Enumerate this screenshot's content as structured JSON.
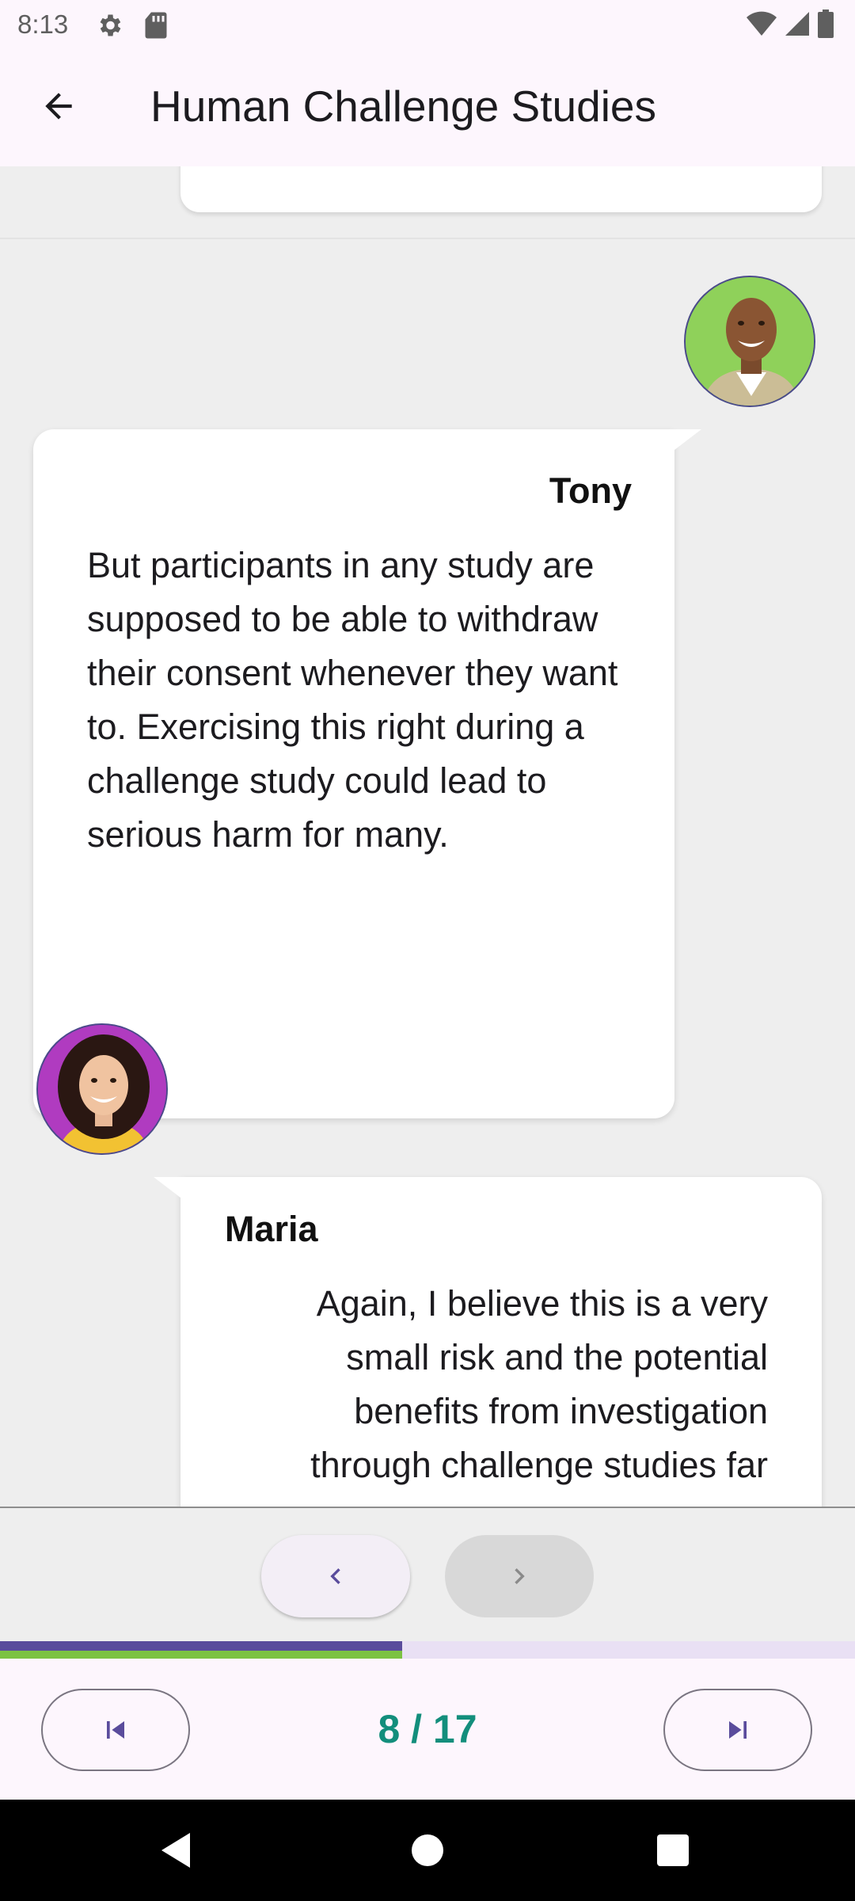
{
  "status_bar": {
    "time": "8:13",
    "icons": [
      "settings-gear-icon",
      "sd-card-icon",
      "wifi-icon",
      "signal-icon",
      "battery-icon"
    ]
  },
  "app_bar": {
    "title": "Human Challenge Studies",
    "back_icon": "arrow-back-icon"
  },
  "messages": [
    {
      "speaker": "Tony",
      "avatar": "tony-avatar",
      "text": "But participants in any study are supposed to be able to withdraw their consent whenever they want to. Exercising this right during a challenge study could lead to serious harm for many."
    },
    {
      "speaker": "Maria",
      "avatar": "maria-avatar",
      "text": "Again, I believe this is a very small risk and the potential benefits from investigation through challenge studies far"
    }
  ],
  "navigation": {
    "prev_icon": "chevron-left-icon",
    "next_icon": "chevron-right-icon",
    "next_enabled": false
  },
  "progress": {
    "current": 8,
    "total": 17,
    "fraction": 0.47,
    "colors": {
      "fill_top": "#5a4c9c",
      "fill_bottom": "#7cc242",
      "track": "#e9e0f4"
    }
  },
  "bottom_bar": {
    "page_indicator": "8 / 17",
    "first_icon": "skip-previous-icon",
    "last_icon": "skip-next-icon"
  },
  "colors": {
    "accent": "#5a4c9c",
    "page_indicator": "#138e7c",
    "app_bar_bg": "#fdf6fd",
    "chat_bg": "#eeeeee"
  }
}
